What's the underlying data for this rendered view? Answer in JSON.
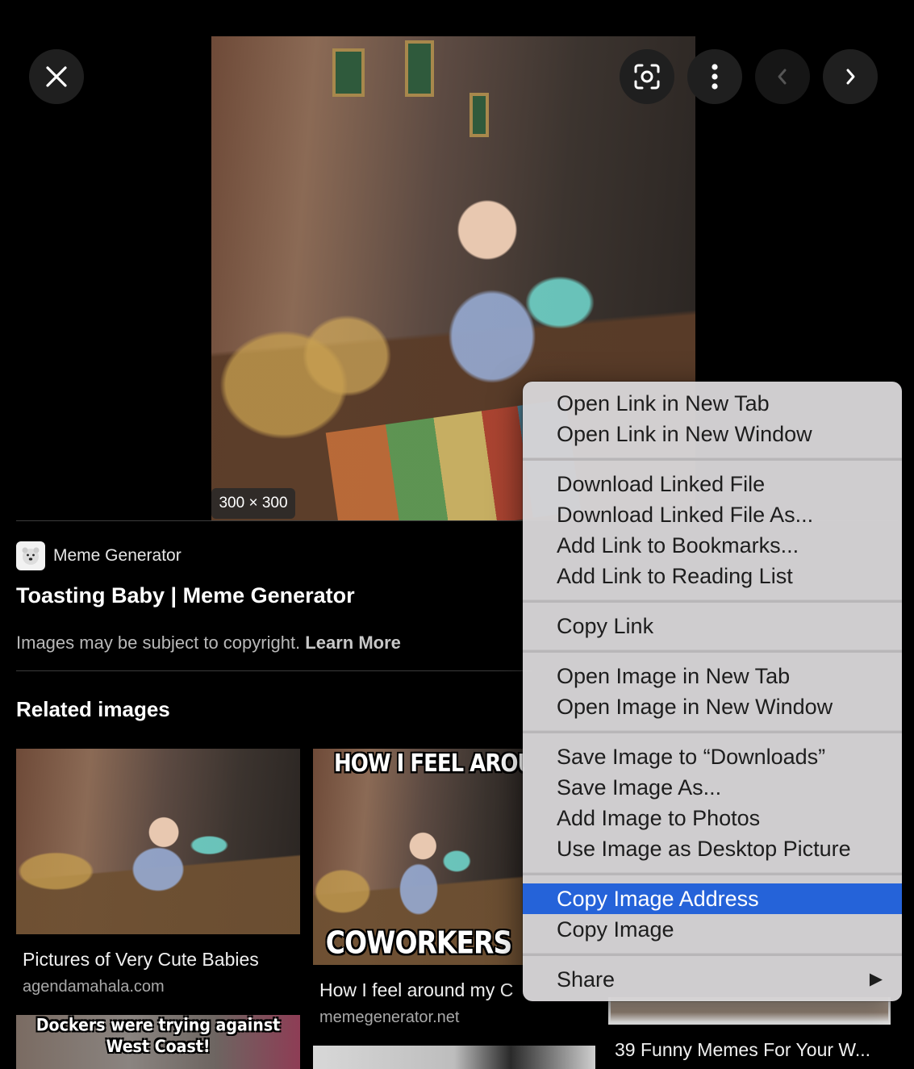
{
  "viewer": {
    "image_dimensions": "300 × 300",
    "source_name": "Meme Generator",
    "page_title": "Toasting Baby | Meme Generator",
    "copyright_text": "Images may be subject to copyright.",
    "learn_more": "Learn More",
    "related_heading": "Related images"
  },
  "related": [
    {
      "caption": "Pictures of Very Cute Babies",
      "domain": "agendamahala.com"
    },
    {
      "caption": "How I feel around my C",
      "domain": "memegenerator.net",
      "top_text": "HOW I FEEL AROUN",
      "bottom_text": "COWORKERS"
    },
    {
      "caption": "39 Funny Memes For Your W..."
    },
    {
      "top_text": "Dockers were trying against West Coast!"
    }
  ],
  "context_menu": {
    "items": [
      "Open Link in New Tab",
      "Open Link in New Window",
      "Download Linked File",
      "Download Linked File As...",
      "Add Link to Bookmarks...",
      "Add Link to Reading List",
      "Copy Link",
      "Open Image in New Tab",
      "Open Image in New Window",
      "Save Image to “Downloads”",
      "Save Image As...",
      "Add Image to Photos",
      "Use Image as Desktop Picture",
      "Copy Image Address",
      "Copy Image",
      "Share"
    ],
    "highlighted": "Copy Image Address",
    "submenu_arrow": "▶"
  },
  "icons": {
    "close": "close-icon",
    "lens": "lens-icon",
    "more": "more-vert-icon",
    "prev": "chevron-left-icon",
    "next": "chevron-right-icon"
  },
  "colors": {
    "background": "#000000",
    "menu_background": "#d6d4d6",
    "menu_highlight": "#2563d9"
  }
}
